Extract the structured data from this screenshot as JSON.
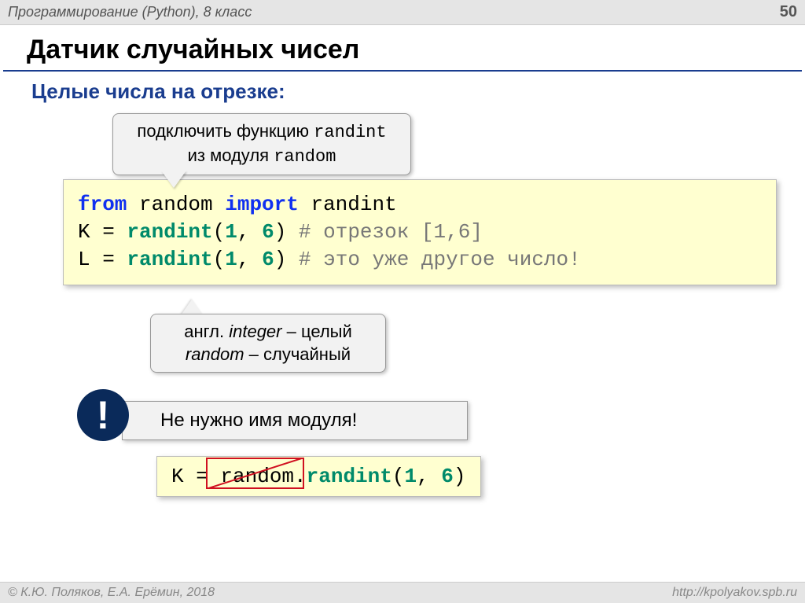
{
  "header": {
    "course": "Программирование (Python), 8 класс",
    "pagenum": "50"
  },
  "title": "Датчик случайных чисел",
  "subtitle": "Целые числа на отрезке:",
  "callout1": {
    "line1_a": "подключить функцию ",
    "line1_b": "randint",
    "line2_a": "из модуля ",
    "line2_b": "random"
  },
  "code1": {
    "l1_a": "from",
    "l1_b": " random ",
    "l1_c": "import",
    "l1_d": " randint",
    "l2_a": "K = ",
    "l2_b": "randint",
    "l2_c": "(",
    "l2_d": "1",
    "l2_e": ", ",
    "l2_f": "6",
    "l2_g": ") ",
    "l2_h": "# отрезок [1,6]",
    "l3_a": "L = ",
    "l3_b": "randint",
    "l3_c": "(",
    "l3_d": "1",
    "l3_e": ", ",
    "l3_f": "6",
    "l3_g": ") ",
    "l3_h": "# это уже другое число!"
  },
  "callout2": {
    "l1_a": "англ. ",
    "l1_b": "integer",
    "l1_c": " – целый",
    "l2_a": "random",
    "l2_b": " – случайный"
  },
  "note": {
    "bang": "!",
    "text": "Не нужно имя модуля!"
  },
  "code2": {
    "a": "K = ",
    "b": "random.",
    "c": "randint",
    "d": "(",
    "e": "1",
    "f": ", ",
    "g": "6",
    "h": ")"
  },
  "footer": {
    "left": "© К.Ю. Поляков, Е.А. Ерёмин, 2018",
    "right": "http://kpolyakov.spb.ru"
  }
}
